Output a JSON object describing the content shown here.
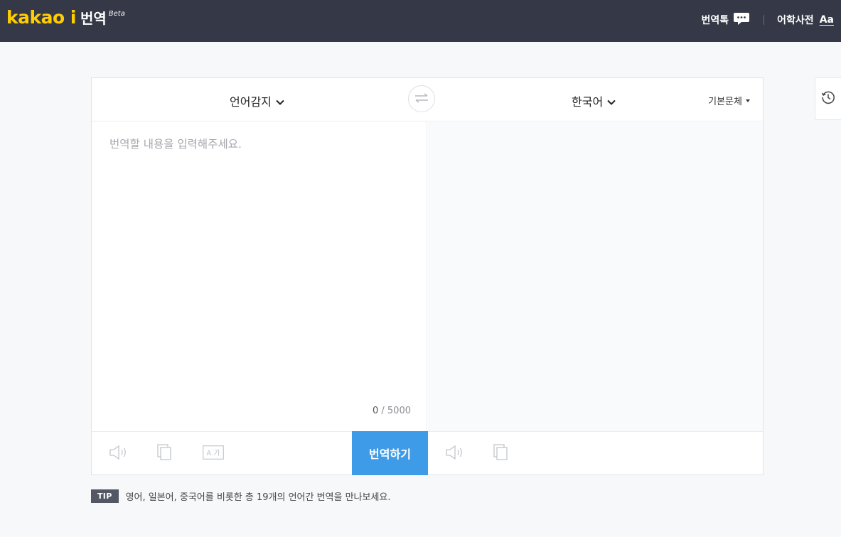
{
  "brand": {
    "logo_text": "kakao i",
    "service_name": "번역",
    "beta_label": "Beta",
    "accent_color": "#ffcd00"
  },
  "topnav": {
    "items": [
      {
        "label": "번역톡",
        "icon": "speech-bubble-icon"
      },
      {
        "label": "어학사전",
        "icon": "aa-dictionary-icon",
        "icon_text": "Aa"
      }
    ]
  },
  "translator": {
    "source_language": "언어감지",
    "target_language": "한국어",
    "font_option": "기본문체",
    "swap_icon": "swap-arrows-icon",
    "source_placeholder": "번역할 내용을 입력해주세요.",
    "source_value": "",
    "char_count": "0",
    "char_limit": "/ 5000",
    "source_tools": [
      "speaker-icon",
      "copy-icon",
      "font-size-icon"
    ],
    "font_size_icon_text": "A 가",
    "target_tools": [
      "speaker-icon",
      "copy-icon"
    ],
    "translate_button": "번역하기",
    "button_color": "#3e9be7"
  },
  "history": {
    "icon": "clock-history-icon"
  },
  "tip": {
    "badge": "TIP",
    "text": "영어, 일본어, 중국어를 비롯한 총 19개의 언어간 번역을 만나보세요."
  }
}
